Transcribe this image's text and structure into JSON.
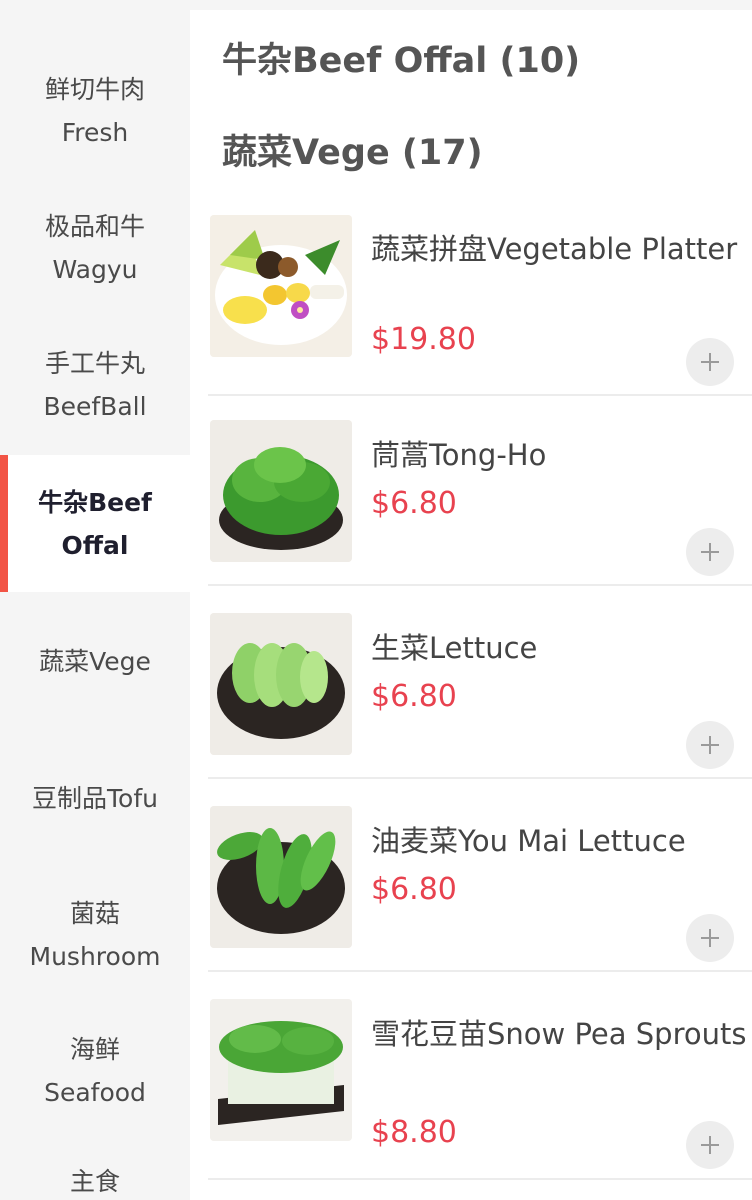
{
  "sidebar": {
    "categories": [
      {
        "line1": "鲜切牛肉",
        "line2": "Fresh"
      },
      {
        "line1": "极品和牛",
        "line2": "Wagyu"
      },
      {
        "line1": "手工牛丸",
        "line2": "BeefBall"
      },
      {
        "line1": "牛杂Beef",
        "line2": "Offal"
      },
      {
        "line1": "蔬菜Vege",
        "line2": ""
      },
      {
        "line1": "豆制品Tofu",
        "line2": ""
      },
      {
        "line1": "菌菇",
        "line2": "Mushroom"
      },
      {
        "line1": "海鲜",
        "line2": "Seafood"
      },
      {
        "line1": "主食",
        "line2": ""
      }
    ],
    "active_index": 3,
    "accent_color": "#f25445"
  },
  "main": {
    "sections": [
      {
        "title": "牛杂Beef Offal (10)"
      },
      {
        "title": "蔬菜Vege (17)"
      }
    ],
    "items": [
      {
        "name": "蔬菜拼盘Vegetable Platter",
        "price": "$19.80",
        "image": "vegetable-platter-image"
      },
      {
        "name": "茼蒿Tong-Ho",
        "price": "$6.80",
        "image": "tong-ho-image"
      },
      {
        "name": "生菜Lettuce",
        "price": "$6.80",
        "image": "lettuce-image"
      },
      {
        "name": "油麦菜You Mai Lettuce",
        "price": "$6.80",
        "image": "you-mai-lettuce-image"
      },
      {
        "name": "雪花豆苗Snow Pea Sprouts",
        "price": "$8.80",
        "image": "snow-pea-sprouts-image"
      }
    ],
    "add_icon": "plus-icon",
    "price_color": "#e8424f"
  }
}
